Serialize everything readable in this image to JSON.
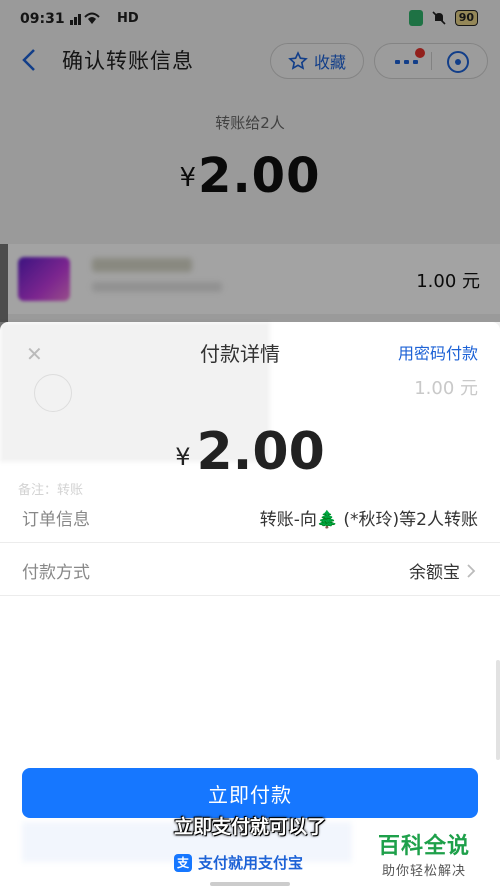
{
  "status_bar": {
    "time": "09:31",
    "network": "HD",
    "battery": "90"
  },
  "nav": {
    "title": "确认转账信息",
    "favorite_label": "收藏"
  },
  "summary": {
    "transfer_to": "转账给2人",
    "currency": "¥",
    "amount": "2.00"
  },
  "recipient": {
    "amount": "1.00 元"
  },
  "sheet": {
    "title": "付款详情",
    "password_link": "用密码付款",
    "currency": "¥",
    "amount": "2.00",
    "ghost_amount": "1.00 元",
    "ghost_note": "备注：转账",
    "order_label": "订单信息",
    "order_value": "转账-向🌲 (*秋玲)等2人转账",
    "pay_method_label": "付款方式",
    "pay_method_value": "余额宝",
    "pay_button": "立即付款",
    "footer": "支付就用支付宝"
  },
  "caption": "立即支付就可以了",
  "watermark": {
    "title": "百科全说",
    "subtitle": "助你轻松解决"
  },
  "colors": {
    "primary": "#1677ff",
    "link": "#1d62d6",
    "notification": "#e5322d",
    "watermark_green": "#1ea04a"
  }
}
